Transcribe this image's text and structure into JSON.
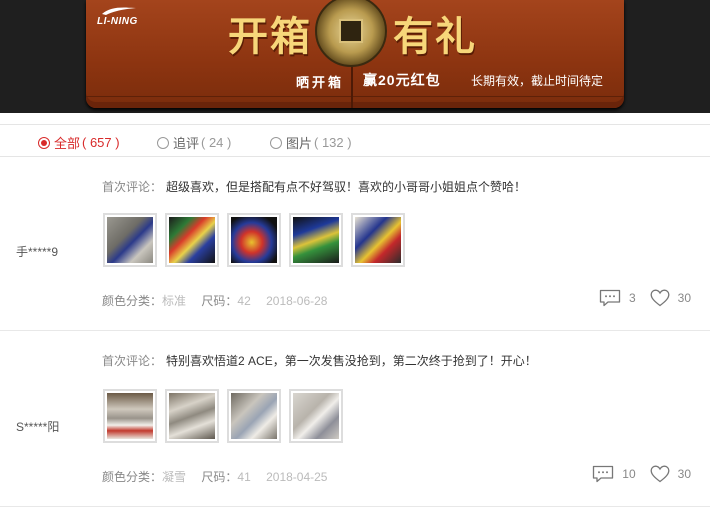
{
  "banner": {
    "logo": "LI-NING",
    "headline_left": "开箱",
    "headline_right": "有礼",
    "sub_left": "晒开箱",
    "sub_mid": "赢20元红包",
    "sub_right": "长期有效，截止时间待定"
  },
  "filters": [
    {
      "label": "全部",
      "count": "( 657 )",
      "active": true
    },
    {
      "label": "追评",
      "count": "( 24 )",
      "active": false
    },
    {
      "label": "图片",
      "count": "( 132 )",
      "active": false
    }
  ],
  "reviews": [
    {
      "user": "手*****9",
      "comment_label": "首次评论：",
      "comment": "超级喜欢，但是搭配有点不好驾驭！喜欢的小哥哥小姐姐点个赞哈！",
      "color_label": "颜色分类：",
      "color": "标准",
      "size_label": "尺码：",
      "size": "42",
      "date": "2018-06-28",
      "comments": "3",
      "likes": "30"
    },
    {
      "user": "S*****阳",
      "comment_label": "首次评论：",
      "comment": "特别喜欢悟道2 ACE，第一次发售没抢到，第二次终于抢到了！开心！",
      "color_label": "颜色分类：",
      "color": "凝雪",
      "size_label": "尺码：",
      "size": "41",
      "date": "2018-04-25",
      "comments": "10",
      "likes": "30"
    }
  ],
  "colors": {
    "accent": "#d82a2a",
    "banner_wood": "#8c3410",
    "banner_gold": "#f7d77a"
  }
}
